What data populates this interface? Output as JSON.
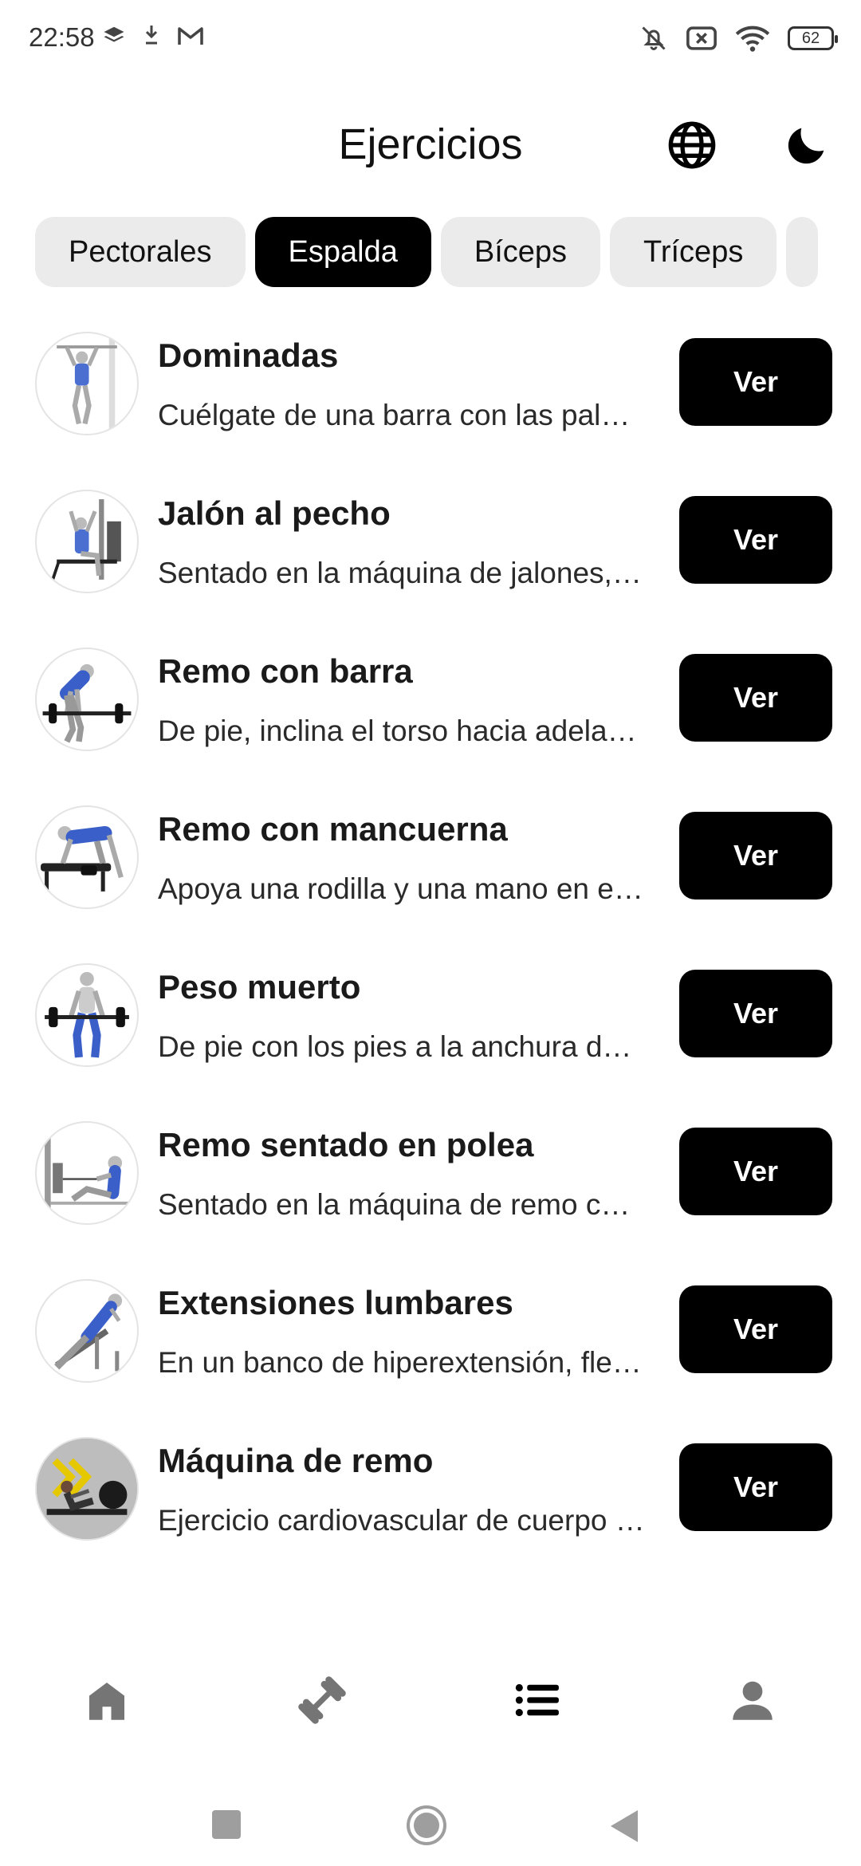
{
  "status_bar": {
    "time": "22:58",
    "battery": "62",
    "icons_left": [
      "layers-icon",
      "download-icon",
      "gmail-icon"
    ],
    "icons_right": [
      "bell-off-icon",
      "no-sim-icon",
      "wifi-icon",
      "battery-icon"
    ]
  },
  "header": {
    "title": "Ejercicios",
    "icons": [
      "globe-icon",
      "moon-icon"
    ]
  },
  "tabs": [
    {
      "label": "Pectorales",
      "active": false
    },
    {
      "label": "Espalda",
      "active": true
    },
    {
      "label": "Bíceps",
      "active": false
    },
    {
      "label": "Tríceps",
      "active": false
    },
    {
      "label": "",
      "active": false
    }
  ],
  "exercises": [
    {
      "title": "Dominadas",
      "description": "Cuélgate de una barra con las palmas mirando hacia delante y las manos más anchas que los hombros.",
      "button": "Ver",
      "thumb": "pull-up-figure"
    },
    {
      "title": "Jalón al pecho",
      "description": "Sentado en la máquina de jalones, sujeta la barra y tira hacia el pecho.",
      "button": "Ver",
      "thumb": "lat-pulldown-figure"
    },
    {
      "title": "Remo con barra",
      "description": "De pie, inclina el torso hacia adelante y tira de la barra hacia el abdomen.",
      "button": "Ver",
      "thumb": "barbell-row-figure"
    },
    {
      "title": "Remo con mancuerna",
      "description": "Apoya una rodilla y una mano en el banco y tira de la mancuerna hacia la cadera.",
      "button": "Ver",
      "thumb": "dumbbell-row-figure"
    },
    {
      "title": "Peso muerto",
      "description": "De pie con los pies a la anchura de las caderas, levanta la barra desde el suelo.",
      "button": "Ver",
      "thumb": "deadlift-figure"
    },
    {
      "title": "Remo sentado en polea",
      "description": "Sentado en la máquina de remo con polea, tira del agarre hacia el abdomen.",
      "button": "Ver",
      "thumb": "seated-cable-row-figure"
    },
    {
      "title": "Extensiones lumbares",
      "description": "En un banco de hiperextensión, flexiona la cadera y vuelve a subir.",
      "button": "Ver",
      "thumb": "back-extension-figure"
    },
    {
      "title": "Máquina de remo",
      "description": "Ejercicio cardiovascular de cuerpo completo en la máquina de remo.",
      "button": "Ver",
      "thumb": "rowing-machine-photo"
    }
  ],
  "bottom_nav": [
    {
      "name": "home-icon",
      "active": false
    },
    {
      "name": "dumbbell-icon",
      "active": false
    },
    {
      "name": "list-icon",
      "active": true
    },
    {
      "name": "person-icon",
      "active": false
    }
  ],
  "colors": {
    "accent": "#000000",
    "tab_inactive": "#ebebeb",
    "nav_inactive": "#757575"
  }
}
